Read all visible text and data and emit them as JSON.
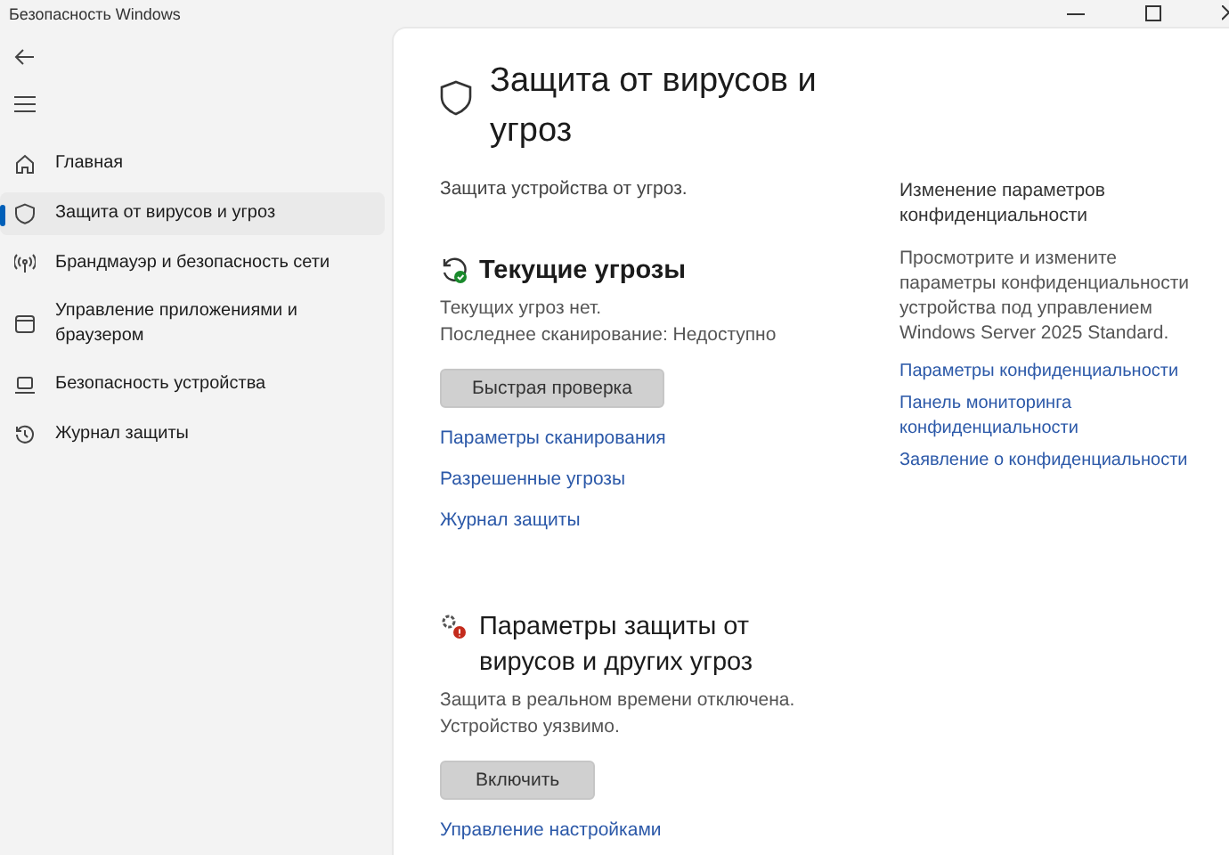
{
  "window": {
    "title": "Безопасность Windows"
  },
  "sidebar": {
    "items": [
      {
        "label": "Главная",
        "kind": "home",
        "selected": false
      },
      {
        "label": "Защита от вирусов и угроз",
        "kind": "shield",
        "selected": true
      },
      {
        "label": "Брандмауэр и безопасность сети",
        "kind": "antenna",
        "selected": false
      },
      {
        "label": "Управление приложениями и браузером",
        "kind": "window",
        "selected": false
      },
      {
        "label": "Безопасность устройства",
        "kind": "laptop",
        "selected": false
      },
      {
        "label": "Журнал защиты",
        "kind": "history",
        "selected": false
      }
    ]
  },
  "page": {
    "title": "Защита от вирусов и угроз",
    "subtitle": "Защита устройства от угроз."
  },
  "sections": [
    {
      "kind": "threats",
      "title": "Текущие угрозы",
      "lines": [
        "Текущих угроз нет.",
        "Последнее сканирование: Недоступно"
      ],
      "button": "Быстрая проверка",
      "links": [
        "Параметры сканирования",
        "Разрешенные угрозы",
        "Журнал защиты"
      ]
    },
    {
      "kind": "settings",
      "title": "Параметры защиты от вирусов и других угроз",
      "lines": [
        "Защита в реальном времени отключена.",
        "Устройство уязвимо."
      ],
      "button": "Включить",
      "links": [
        "Управление настройками"
      ]
    }
  ],
  "aside": {
    "title": "Изменение параметров конфиденциальности",
    "text": "Просмотрите и измените параметры конфиденциальности устройства под управлением Windows Server 2025 Standard.",
    "links": [
      "Параметры конфиденциальности",
      "Панель мониторинга конфиденциальности",
      "Заявление о конфиденциальности"
    ]
  }
}
